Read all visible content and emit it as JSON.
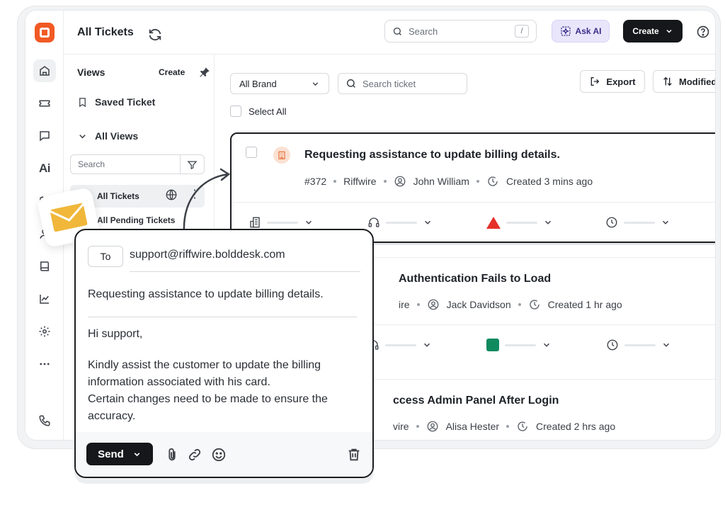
{
  "header": {
    "title": "All Tickets",
    "search_placeholder": "Search",
    "search_shortcut": "/",
    "ask_ai_label": "Ask AI",
    "create_label": "Create"
  },
  "rail": {
    "ai_label": "Ai",
    "items": [
      "home-icon",
      "ticket-icon",
      "chat-icon",
      "ai-icon",
      "calendar-icon",
      "user-icon",
      "book-icon",
      "chart-icon",
      "gear-icon",
      "more-icon",
      "phone-icon"
    ]
  },
  "views": {
    "title": "Views",
    "create_label": "Create",
    "saved_label": "Saved Ticket",
    "all_views_label": "All Views",
    "search_placeholder": "Search",
    "items": [
      {
        "label": "All Tickets"
      },
      {
        "label": "All Pending Tickets"
      }
    ]
  },
  "toolbar": {
    "brand_select_value": "All Brand",
    "ticket_search_placeholder": "Search ticket",
    "export_label": "Export",
    "sort_label": "Modified",
    "select_all_label": "Select All"
  },
  "tickets": [
    {
      "title": "Requesting assistance to update billing details.",
      "id": "#372",
      "brand": "Riffwire",
      "agent": "John William",
      "created": "Created 3 mins ago",
      "priority_color": "#e5302b"
    },
    {
      "title": "Authentication Fails to Load",
      "brand_partial": "ire",
      "agent": "Jack Davidson",
      "created": "Created 1 hr ago",
      "priority_color": "#0f8a5f"
    },
    {
      "title": "ccess Admin Panel After Login",
      "brand_partial": "vire",
      "agent": "Alisa Hester",
      "created": "Created 2 hrs ago"
    }
  ],
  "email": {
    "to_label": "To",
    "to_value": "support@riffwire.bolddesk.com",
    "subject": "Requesting assistance to update billing details.",
    "greeting": "Hi support,",
    "body_lines": [
      "Kindly assist the customer to update the billing",
      "information associated with his card.",
      "Certain changes need to be made to ensure the",
      "accuracy."
    ],
    "send_label": "Send"
  },
  "colors": {
    "brand_orange": "#f15a24",
    "ai_purple": "#e9e6fb",
    "dark_button": "#15171a",
    "priority_high": "#e5302b",
    "status_green": "#0f8a5f"
  }
}
